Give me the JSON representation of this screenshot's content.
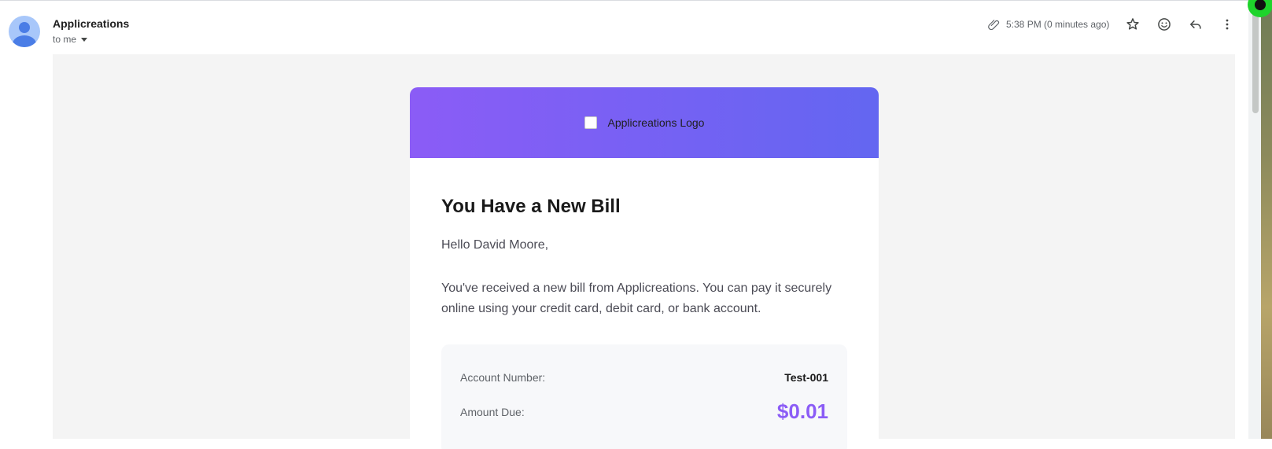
{
  "email": {
    "sender_name": "Applicreations",
    "recipient_label": "to me",
    "timestamp": "5:38 PM (0 minutes ago)",
    "icons": {
      "attachment": "paperclip-icon",
      "star": "star-icon",
      "emoji": "emoji-icon",
      "reply": "reply-icon",
      "more": "more-vert-icon"
    }
  },
  "message": {
    "logo_alt": "Applicreations Logo",
    "title": "You Have a New Bill",
    "greeting": "Hello David Moore,",
    "paragraph": "You've received a new bill from Applicreations. You can pay it securely online using your credit card, debit card, or bank account.",
    "details": {
      "account_label": "Account Number:",
      "account_value": "Test-001",
      "amount_label": "Amount Due:",
      "amount_value": "$0.01"
    }
  },
  "colors": {
    "header_gradient_start": "#8b5cf6",
    "header_gradient_end": "#6366f1",
    "amount_accent": "#8b5cf6"
  }
}
